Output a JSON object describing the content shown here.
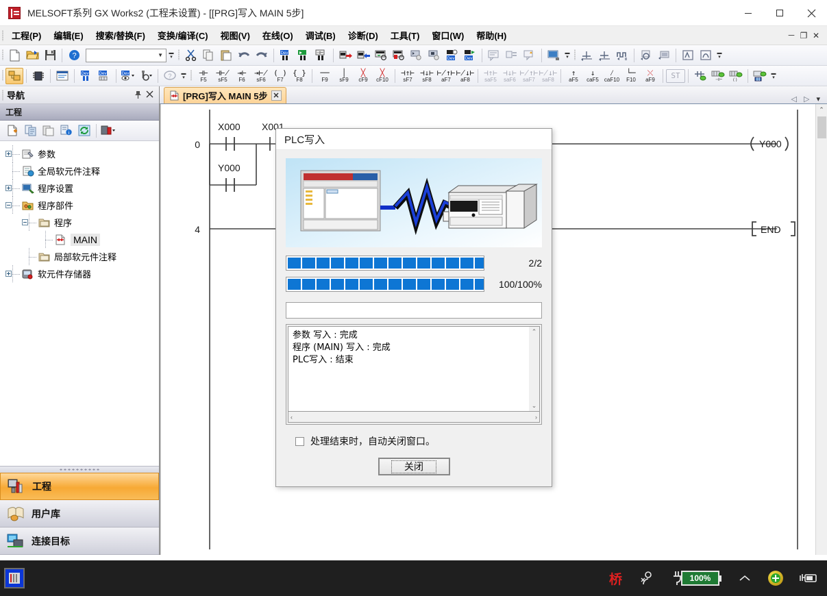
{
  "window": {
    "title": "MELSOFT系列 GX Works2 (工程未设置) - [[PRG]写入 MAIN 5步]",
    "app_icon": "melsoft-icon",
    "minimize": "－",
    "maximize": "□",
    "close": "✕"
  },
  "menubar": {
    "items": [
      {
        "label": "工程(P)"
      },
      {
        "label": "编辑(E)"
      },
      {
        "label": "搜索/替换(F)"
      },
      {
        "label": "变换/编译(C)"
      },
      {
        "label": "视图(V)"
      },
      {
        "label": "在线(O)"
      },
      {
        "label": "调试(B)"
      },
      {
        "label": "诊断(D)"
      },
      {
        "label": "工具(T)"
      },
      {
        "label": "窗口(W)"
      },
      {
        "label": "帮助(H)"
      }
    ],
    "doc_minimize": "－",
    "doc_restore": "❐",
    "doc_close": "✕"
  },
  "toolbar_main": {
    "combo_value": "",
    "overflow": "▾"
  },
  "toolbar_ladder": {
    "buttons": [
      {
        "symbol": "⊣⊢",
        "key": "F5",
        "dim": false
      },
      {
        "symbol": "⊣⊬",
        "key": "sF5",
        "dim": false
      },
      {
        "symbol": "⇥⊢",
        "key": "F6",
        "dim": false
      },
      {
        "symbol": "⇥⊬",
        "key": "sF6",
        "dim": false
      },
      {
        "symbol": "( )",
        "key": "F7",
        "dim": false
      },
      {
        "symbol": "{ }",
        "key": "F8",
        "dim": false
      },
      {
        "symbol": "──",
        "key": "F9",
        "dim": false
      },
      {
        "symbol": "│",
        "key": "sF9",
        "dim": false
      },
      {
        "symbol": "╳",
        "key": "cF9",
        "dim": false
      },
      {
        "symbol": "╳",
        "key": "cF10",
        "dim": false
      },
      {
        "symbol": "⊣↑⊢",
        "key": "sF7",
        "dim": false
      },
      {
        "symbol": "⊣↓⊢",
        "key": "sF8",
        "dim": false
      },
      {
        "symbol": "⊬↑⊢",
        "key": "aF7",
        "dim": false
      },
      {
        "symbol": "⊬↓⊢",
        "key": "aF8",
        "dim": false
      },
      {
        "symbol": "⊣↑⊢",
        "key": "saF5",
        "dim": true
      },
      {
        "symbol": "⊣↓⊢",
        "key": "saF6",
        "dim": true
      },
      {
        "symbol": "⊬↑⊢",
        "key": "saF7",
        "dim": true
      },
      {
        "symbol": "⊬↓⊢",
        "key": "saF8",
        "dim": true
      },
      {
        "symbol": "↑",
        "key": "aF5",
        "dim": false
      },
      {
        "symbol": "↓",
        "key": "caF5",
        "dim": false
      },
      {
        "symbol": "⁄",
        "key": "caF10",
        "dim": false
      },
      {
        "symbol": "└─",
        "key": "F10",
        "dim": false
      },
      {
        "symbol": "⤬",
        "key": "aF9",
        "dim": false
      },
      {
        "symbol": "ST",
        "key": "",
        "dim": true
      }
    ]
  },
  "navigation": {
    "title": "导航",
    "pin_icon": "pin-icon",
    "close_icon": "close-icon",
    "section_label": "工程",
    "tree": [
      {
        "label": "参数",
        "level": 0,
        "expander": "plus",
        "icon": "parameter-icon",
        "selected": false
      },
      {
        "label": "全局软元件注释",
        "level": 0,
        "expander": "none",
        "icon": "global-comment-icon",
        "selected": false
      },
      {
        "label": "程序设置",
        "level": 0,
        "expander": "plus",
        "icon": "program-setting-icon",
        "selected": false
      },
      {
        "label": "程序部件",
        "level": 0,
        "expander": "minus",
        "icon": "pou-icon",
        "selected": false
      },
      {
        "label": "程序",
        "level": 1,
        "expander": "minus",
        "icon": "folder-icon",
        "selected": false
      },
      {
        "label": "MAIN",
        "level": 2,
        "expander": "none",
        "icon": "ladder-file-icon",
        "selected": true
      },
      {
        "label": "局部软元件注释",
        "level": 1,
        "expander": "none",
        "icon": "local-comment-icon",
        "selected": false
      },
      {
        "label": "软元件存储器",
        "level": 0,
        "expander": "plus",
        "icon": "device-memory-icon",
        "selected": false
      }
    ],
    "bottom_buttons": [
      {
        "label": "工程",
        "icon": "project-icon",
        "active": true
      },
      {
        "label": "用户库",
        "icon": "userlib-icon",
        "active": false
      },
      {
        "label": "连接目标",
        "icon": "connection-icon",
        "active": false
      }
    ]
  },
  "editor": {
    "tab": {
      "label": "[PRG]写入 MAIN 5步",
      "icon": "ladder-file-icon",
      "close": "✕"
    },
    "tab_nav": {
      "prev": "◁",
      "next": "▷",
      "menu": "▾"
    },
    "ladder": {
      "rungs": [
        {
          "step": "0",
          "contacts": [
            "X000",
            "X001"
          ],
          "branch": "Y000",
          "coil": "Y000"
        },
        {
          "step": "4",
          "instruction": "END"
        }
      ]
    },
    "scrollbar": {
      "up": "⌃",
      "down": "⌄"
    }
  },
  "dialog": {
    "title": "PLC写入",
    "animation_alt": "pc-to-plc-transfer-animation",
    "progress_primary": {
      "blocks": 17,
      "label": "2/2"
    },
    "progress_secondary": {
      "blocks": 17,
      "label": "100/100%"
    },
    "status_value": "",
    "log_lines": [
      "参数 写入 : 完成",
      "程序 (MAIN) 写入 : 完成",
      "PLC写入 : 结束"
    ],
    "log_scroll": {
      "up": "⌃",
      "down": "⌄",
      "left": "‹",
      "right": "›"
    },
    "checkbox": {
      "label": "处理结束时，自动关闭窗口。",
      "checked": false
    },
    "close_button": "关闭"
  },
  "taskbar": {
    "app_icon": "gxworks-taskbar-icon",
    "tray": {
      "ime": "桥",
      "people_icon": "people-icon",
      "battery_label": "100%",
      "chevron": "⌃",
      "update_icon": "update-icon",
      "power_icon": "power-plug-icon"
    }
  }
}
